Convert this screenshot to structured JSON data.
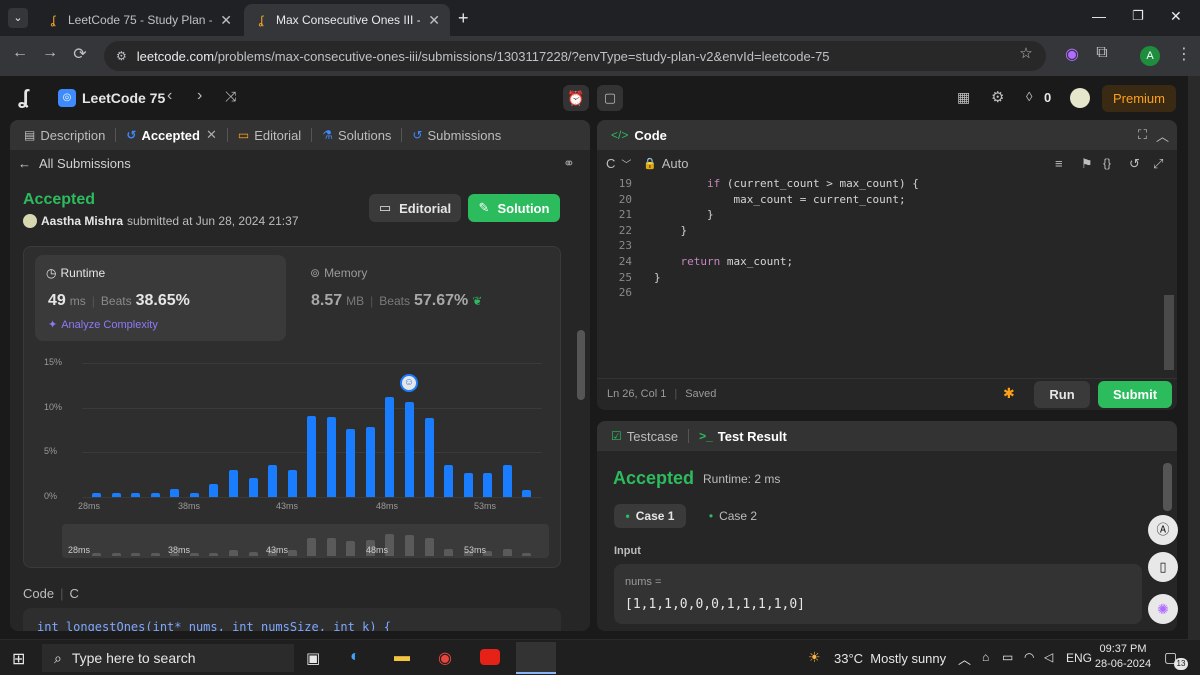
{
  "browser": {
    "tabs": [
      {
        "title": "LeetCode 75 - Study Plan - Leet"
      },
      {
        "title": "Max Consecutive Ones III - Leet"
      }
    ],
    "url_host": "leetcode.com",
    "url_path": "/problems/max-consecutive-ones-iii/submissions/1303117228/?envType=study-plan-v2&envId=leetcode-75",
    "profile_initial": "A"
  },
  "header": {
    "plan_title": "LeetCode 75",
    "streak": "0",
    "premium_label": "Premium"
  },
  "left_panel": {
    "tabs": {
      "description": "Description",
      "accepted": "Accepted",
      "editorial": "Editorial",
      "solutions": "Solutions",
      "submissions": "Submissions"
    },
    "back_label": "All Submissions",
    "status": "Accepted",
    "author": "Aastha Mishra",
    "submitted_text": "submitted at Jun 28, 2024 21:37",
    "editorial_btn": "Editorial",
    "solution_btn": "Solution",
    "runtime": {
      "label": "Runtime",
      "value": "49",
      "unit": "ms",
      "beats_label": "Beats",
      "beats_value": "38.65%",
      "analyze": "Analyze Complexity"
    },
    "memory": {
      "label": "Memory",
      "value": "8.57",
      "unit": "MB",
      "beats_label": "Beats",
      "beats_value": "57.67%"
    },
    "code_label": "Code",
    "code_lang": "C",
    "code_preview": "int longestOnes(int* nums, int numsSize, int k) {"
  },
  "chart_data": {
    "type": "bar",
    "ylim": [
      0,
      15
    ],
    "yticks": [
      "15%",
      "10%",
      "5%",
      "0%"
    ],
    "xticks": [
      "28ms",
      "38ms",
      "43ms",
      "48ms",
      "53ms"
    ],
    "values": [
      0.5,
      0.5,
      0.5,
      0.5,
      0.9,
      0.5,
      1.4,
      3.0,
      2.1,
      3.6,
      3.0,
      9.1,
      8.9,
      7.6,
      7.8,
      11.2,
      10.6,
      8.8,
      3.6,
      2.7,
      2.7,
      3.6,
      0.8
    ],
    "highlight_index": 16,
    "mini_xticks": [
      "28ms",
      "38ms",
      "43ms",
      "48ms",
      "53ms"
    ]
  },
  "right_panel": {
    "code_title": "Code",
    "lang": "C",
    "auto": "Auto",
    "lines": [
      {
        "n": "19",
        "code": "        if (current_count > max_count) {"
      },
      {
        "n": "20",
        "code": "            max_count = current_count;"
      },
      {
        "n": "21",
        "code": "        }"
      },
      {
        "n": "22",
        "code": "    }"
      },
      {
        "n": "23",
        "code": ""
      },
      {
        "n": "24",
        "code": "    return max_count;"
      },
      {
        "n": "25",
        "code": "}"
      },
      {
        "n": "26",
        "code": ""
      }
    ],
    "cursor_pos": "Ln 26, Col 1",
    "saved": "Saved",
    "run": "Run",
    "submit": "Submit",
    "testcase_tab": "Testcase",
    "result_tab": "Test Result",
    "result_status": "Accepted",
    "result_runtime": "Runtime: 2 ms",
    "case1": "Case 1",
    "case2": "Case 2",
    "input_label": "Input",
    "input_var": "nums =",
    "input_value": "[1,1,1,0,0,0,1,1,1,1,0]"
  },
  "taskbar": {
    "search_placeholder": "Type here to search",
    "weather": "33°C  Mostly sunny",
    "lang": "ENG",
    "time": "09:37 PM",
    "date": "28-06-2024",
    "notif_count": "13"
  },
  "colors": {
    "accent_green": "#2cbb5d",
    "bar_blue": "#1a7cff",
    "premium": "#ffa116"
  }
}
